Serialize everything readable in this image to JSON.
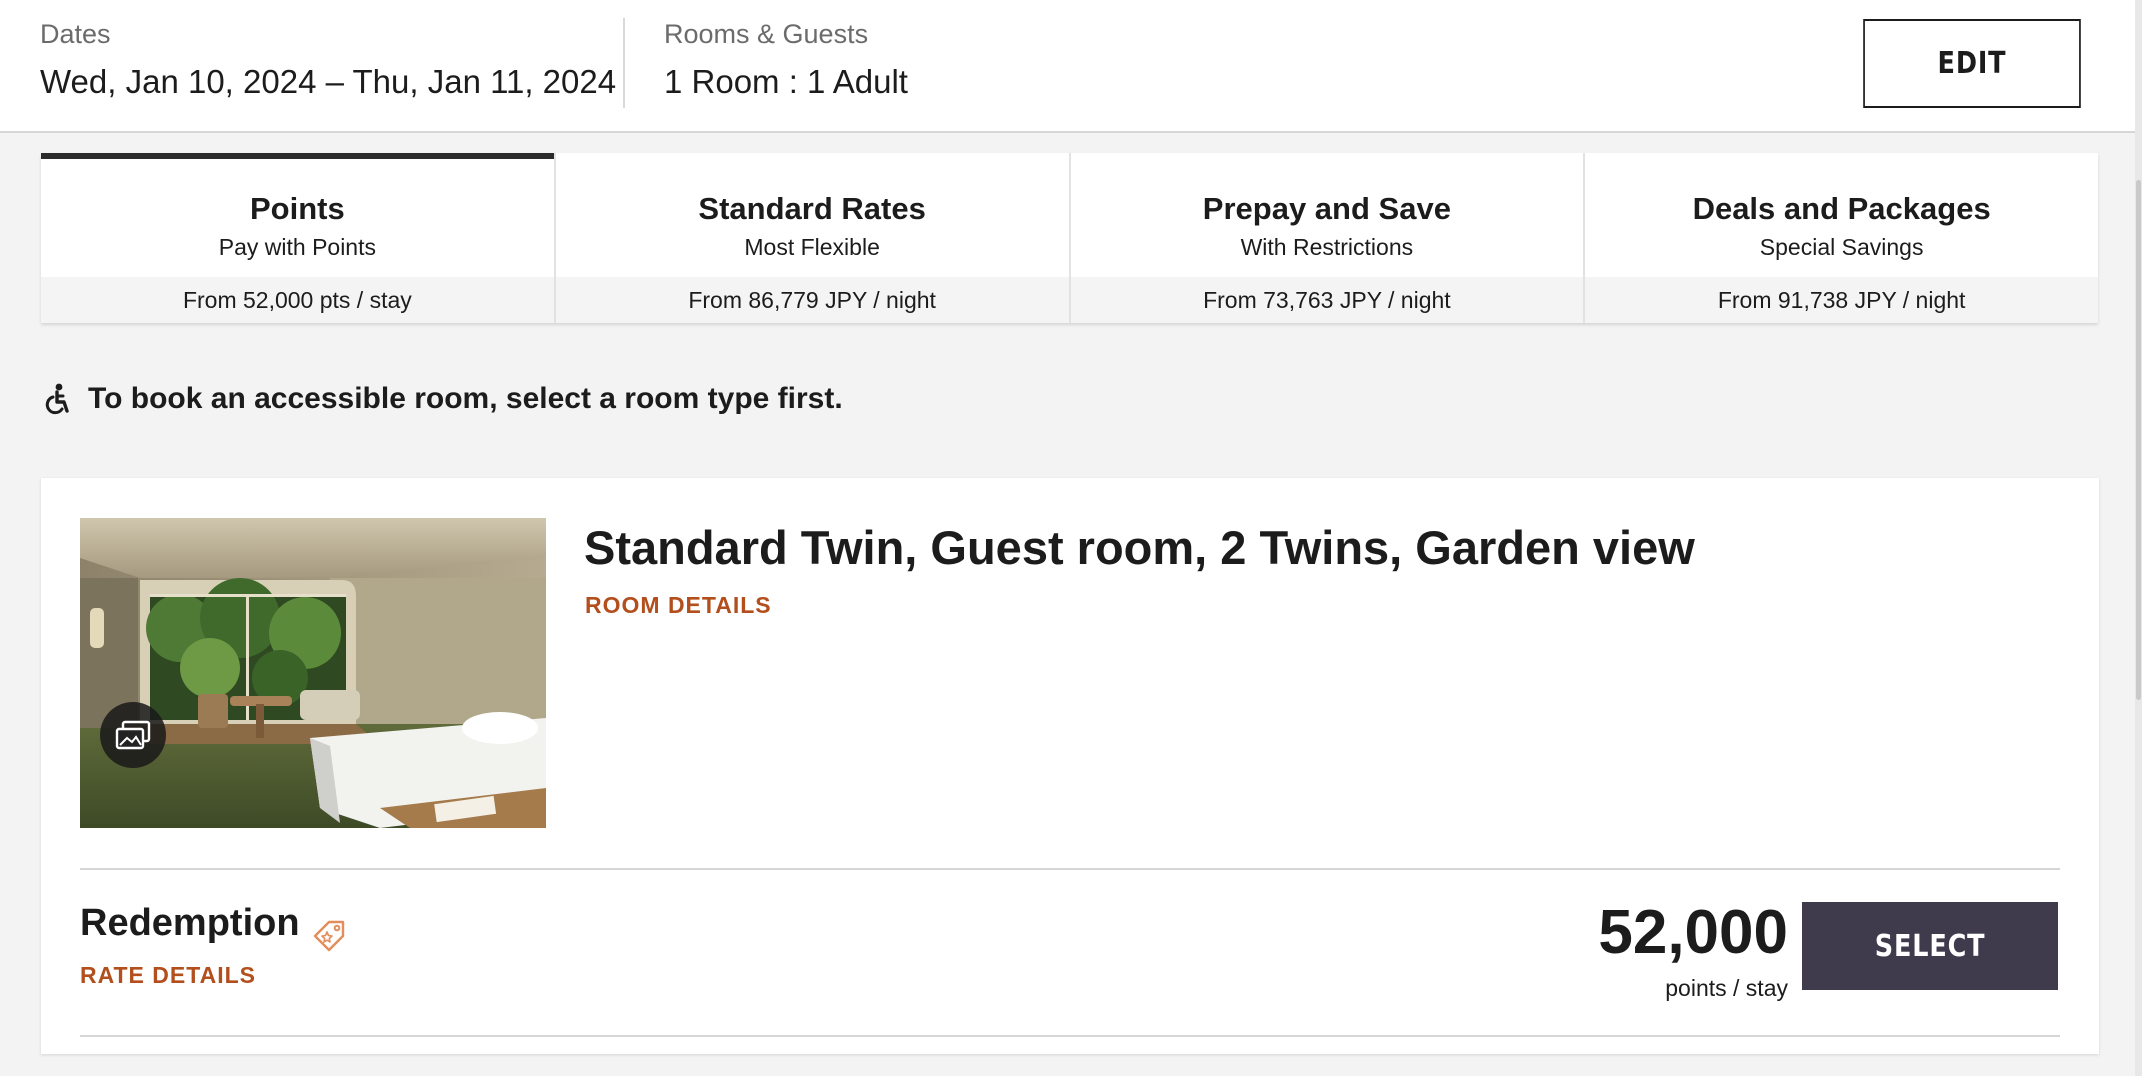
{
  "summary": {
    "dates_label": "Dates",
    "dates_value": "Wed, Jan 10, 2024 – Thu, Jan 11, 2024",
    "rooms_label": "Rooms & Guests",
    "rooms_value": "1 Room : 1 Adult",
    "edit_label": "EDIT"
  },
  "rate_tabs": [
    {
      "title": "Points",
      "subtitle": "Pay with Points",
      "price": "From 52,000 pts / stay",
      "active": true
    },
    {
      "title": "Standard Rates",
      "subtitle": "Most Flexible",
      "price": "From 86,779 JPY / night",
      "active": false
    },
    {
      "title": "Prepay and Save",
      "subtitle": "With Restrictions",
      "price": "From 73,763 JPY / night",
      "active": false
    },
    {
      "title": "Deals and Packages",
      "subtitle": "Special Savings",
      "price": "From 91,738 JPY / night",
      "active": false
    }
  ],
  "accessibility": {
    "icon": "wheelchair-icon",
    "text": "To book an accessible room, select a room type first."
  },
  "room": {
    "title": "Standard Twin, Guest room, 2 Twins, Garden view",
    "details_link": "ROOM DETAILS",
    "gallery_icon": "photo-gallery-icon",
    "rate": {
      "name": "Redemption",
      "tag_icon": "price-tag-icon",
      "details_link": "RATE DETAILS",
      "amount": "52,000",
      "unit": "points / stay",
      "select_label": "SELECT"
    }
  },
  "colors": {
    "accent_link": "#b24f1d",
    "select_button": "#3f3b4d",
    "active_tab_bar": "#2b2b2b",
    "page_background": "#f3f3f3"
  }
}
